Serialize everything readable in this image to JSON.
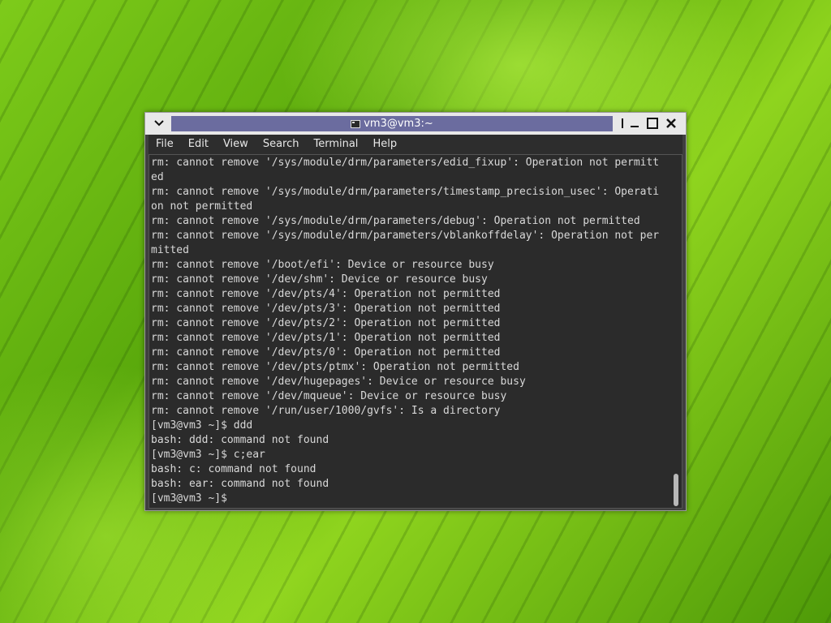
{
  "window": {
    "title": "vm3@vm3:~",
    "menu": [
      "File",
      "Edit",
      "View",
      "Search",
      "Terminal",
      "Help"
    ],
    "buttons": {
      "menu_icon": "chevron-down-icon",
      "minimize_icon": "minimize-icon",
      "maximize_icon": "maximize-icon",
      "close_icon": "close-icon"
    }
  },
  "terminal": {
    "lines": [
      "rm: cannot remove '/sys/module/drm/parameters/edid_fixup': Operation not permitt",
      "ed",
      "rm: cannot remove '/sys/module/drm/parameters/timestamp_precision_usec': Operati",
      "on not permitted",
      "rm: cannot remove '/sys/module/drm/parameters/debug': Operation not permitted",
      "rm: cannot remove '/sys/module/drm/parameters/vblankoffdelay': Operation not per",
      "mitted",
      "rm: cannot remove '/boot/efi': Device or resource busy",
      "rm: cannot remove '/dev/shm': Device or resource busy",
      "rm: cannot remove '/dev/pts/4': Operation not permitted",
      "rm: cannot remove '/dev/pts/3': Operation not permitted",
      "rm: cannot remove '/dev/pts/2': Operation not permitted",
      "rm: cannot remove '/dev/pts/1': Operation not permitted",
      "rm: cannot remove '/dev/pts/0': Operation not permitted",
      "rm: cannot remove '/dev/pts/ptmx': Operation not permitted",
      "rm: cannot remove '/dev/hugepages': Device or resource busy",
      "rm: cannot remove '/dev/mqueue': Device or resource busy",
      "rm: cannot remove '/run/user/1000/gvfs': Is a directory",
      "[vm3@vm3 ~]$ ddd",
      "bash: ddd: command not found",
      "[vm3@vm3 ~]$ c;ear",
      "bash: c: command not found",
      "bash: ear: command not found",
      "[vm3@vm3 ~]$"
    ]
  },
  "colors": {
    "title_bar_active": "#6b6c9f",
    "terminal_bg": "#2b2b2b",
    "terminal_fg": "#d8d8d8"
  }
}
